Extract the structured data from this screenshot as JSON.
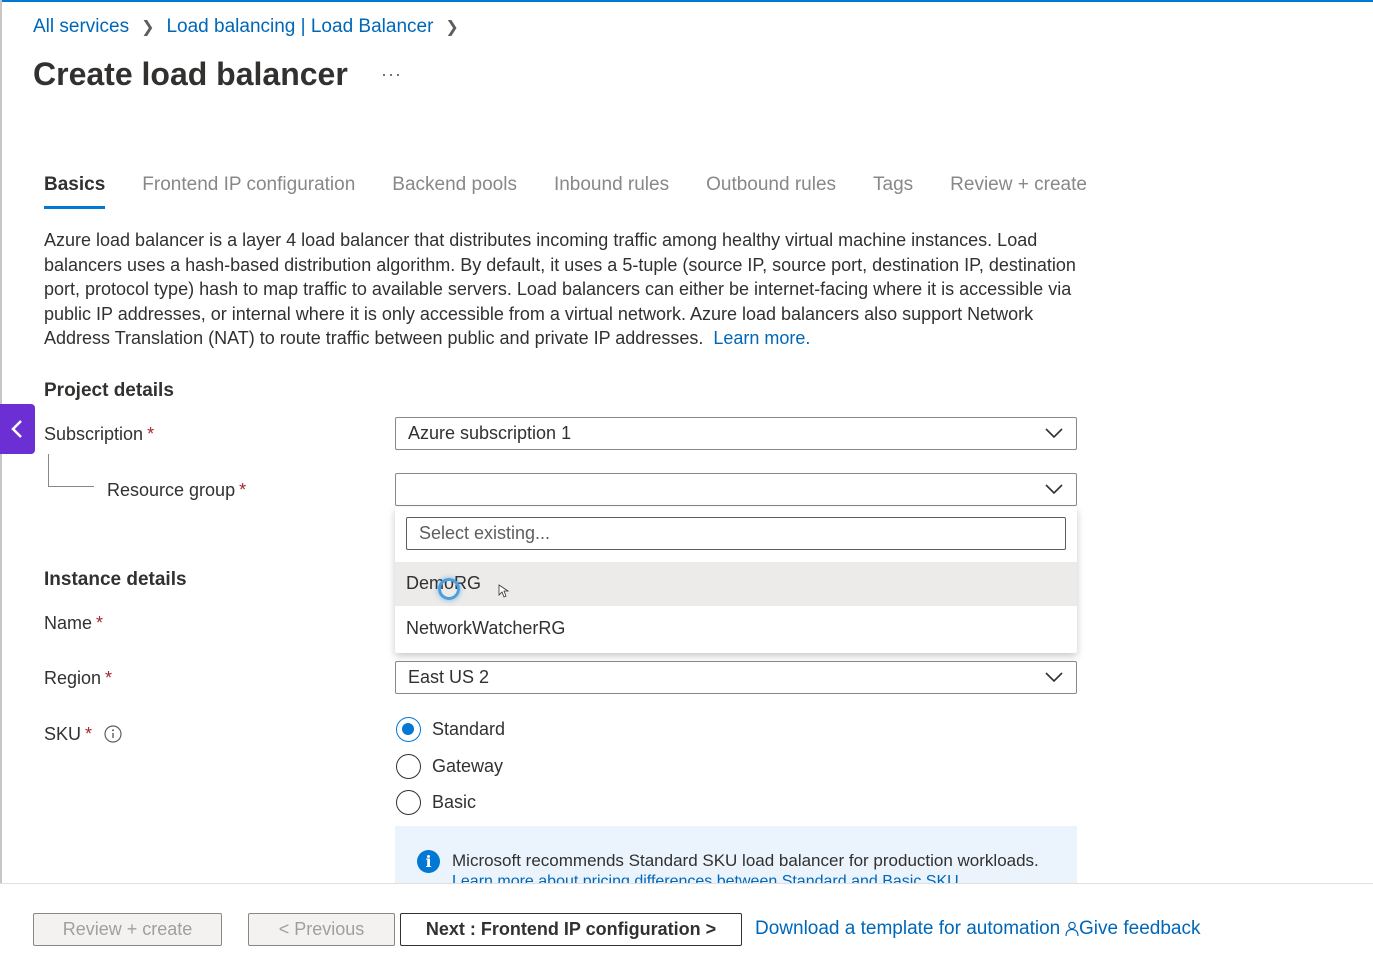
{
  "breadcrumb": {
    "items": [
      "All services",
      "Load balancing | Load Balancer"
    ]
  },
  "page": {
    "title": "Create load balancer",
    "more": "···"
  },
  "tabs": [
    {
      "label": "Basics",
      "active": true
    },
    {
      "label": "Frontend IP configuration"
    },
    {
      "label": "Backend pools"
    },
    {
      "label": "Inbound rules"
    },
    {
      "label": "Outbound rules"
    },
    {
      "label": "Tags"
    },
    {
      "label": "Review + create"
    }
  ],
  "description": {
    "text": "Azure load balancer is a layer 4 load balancer that distributes incoming traffic among healthy virtual machine instances. Load balancers uses a hash-based distribution algorithm. By default, it uses a 5-tuple (source IP, source port, destination IP, destination port, protocol type) hash to map traffic to available servers. Load balancers can either be internet-facing where it is accessible via public IP addresses, or internal where it is only accessible from a virtual network. Azure load balancers also support Network Address Translation (NAT) to route traffic between public and private IP addresses.",
    "learn_more": "Learn more."
  },
  "project_details": {
    "title": "Project details",
    "subscription_label": "Subscription",
    "subscription_value": "Azure subscription 1",
    "resource_group_label": "Resource group",
    "resource_group_value": "",
    "required_mark": "*"
  },
  "resource_group_dropdown": {
    "search_placeholder": "Select existing...",
    "options": [
      "DemoRG",
      "NetworkWatcherRG"
    ],
    "hovered": "DemoRG"
  },
  "instance_details": {
    "title": "Instance details",
    "name_label": "Name",
    "region_label": "Region",
    "region_value": "East US 2",
    "sku_label": "SKU",
    "sku_options": [
      "Standard",
      "Gateway",
      "Basic"
    ],
    "sku_selected": "Standard"
  },
  "info_box": {
    "message": "Microsoft recommends Standard SKU load balancer for production workloads.",
    "link": "Learn more about pricing differences between Standard and Basic SKU"
  },
  "footer": {
    "review_create": "Review + create",
    "previous": "< Previous",
    "next": "Next : Frontend IP configuration >",
    "download_template": "Download a template for automation",
    "feedback": "Give feedback"
  },
  "colors": {
    "accent": "#0078d4",
    "link": "#0067b8",
    "required": "#a4262c",
    "side_handle": "#6b2fd4"
  }
}
